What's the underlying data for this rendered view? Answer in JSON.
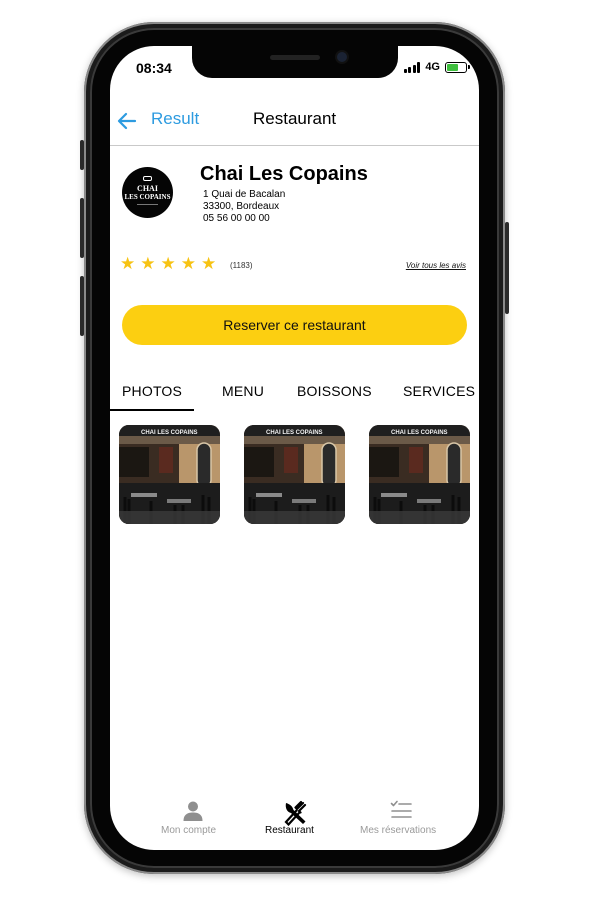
{
  "status_bar": {
    "time": "08:34",
    "network": "4G"
  },
  "nav": {
    "back_label": "Result",
    "title": "Restaurant"
  },
  "restaurant": {
    "name": "Chai Les Copains",
    "logo_text_line1": "CHAI",
    "logo_text_line2": "LES COPAINS",
    "address_line1": "1 Quai de Bacalan",
    "address_line2": "33300, Bordeaux",
    "phone": "05 56 00 00 00",
    "rating_stars": 5,
    "review_count": "(1183)",
    "all_reviews_link": "Voir tous les avis",
    "photo_sign_text": "CHAI LES COPAINS"
  },
  "reserve_button": {
    "label": "Reserver ce restaurant"
  },
  "tabs": [
    {
      "label": "PHOTOS",
      "active": true
    },
    {
      "label": "MENU",
      "active": false
    },
    {
      "label": "BOISSONS",
      "active": false
    },
    {
      "label": "SERVICES",
      "active": false
    }
  ],
  "bottom_nav": [
    {
      "label": "Mon compte",
      "icon": "user-icon",
      "active": false
    },
    {
      "label": "Restaurant",
      "icon": "fork-knife-icon",
      "active": true
    },
    {
      "label": "Mes réservations",
      "icon": "checklist-icon",
      "active": false
    }
  ],
  "colors": {
    "accent_blue": "#2d9be0",
    "button_yellow": "#fccf11",
    "star_yellow": "#f7c313",
    "inactive_gray": "#9a9a9a",
    "battery_green": "#3fbf3f"
  }
}
